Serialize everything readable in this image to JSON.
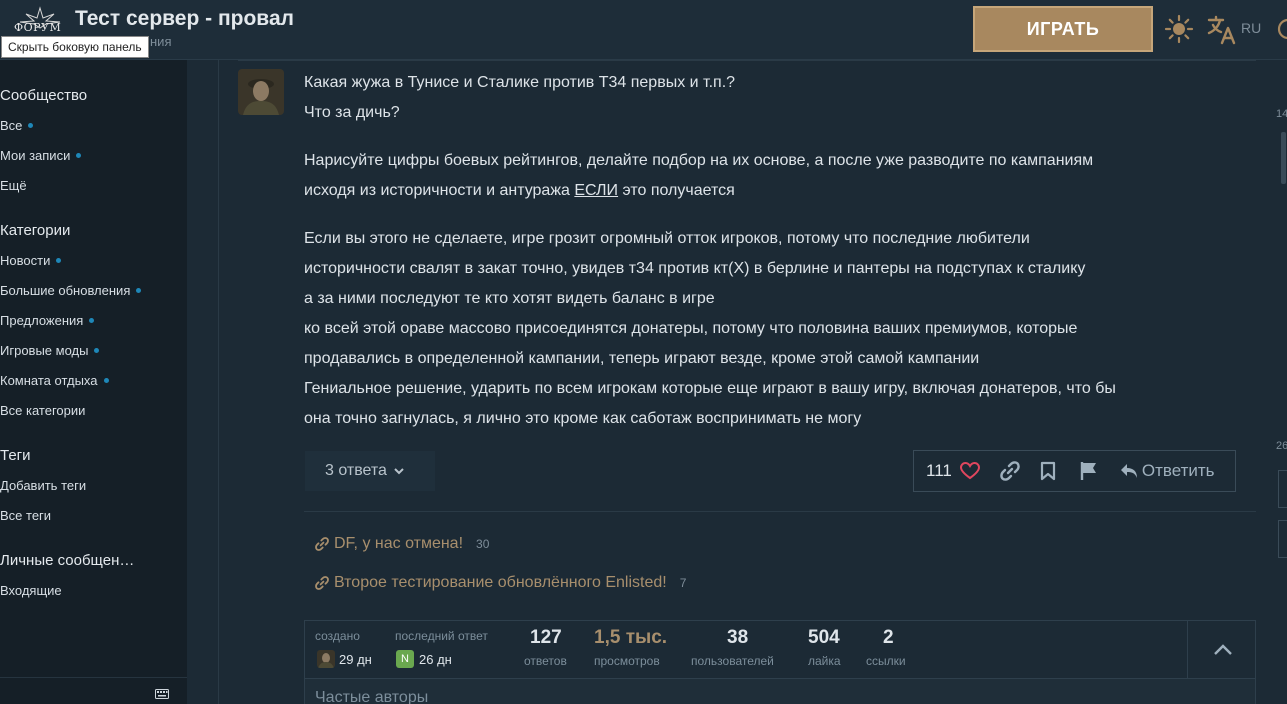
{
  "header": {
    "logo_text": "ФОРУМ",
    "title": "Тест сервер - провал",
    "subtitle": "ния",
    "tooltip": "Скрыть боковую панель",
    "play_label": "ИГРАТЬ",
    "lang": "RU",
    "icons": [
      "sun-icon",
      "translate-icon"
    ]
  },
  "sidebar": {
    "community": {
      "heading": "Сообщество",
      "items": [
        "Все",
        "Мои записи",
        "Ещё"
      ]
    },
    "categories": {
      "heading": "Категории",
      "items": [
        "Новости",
        "Большие обновления",
        "Предложения",
        "Игровые моды",
        "Комната отдыха",
        "Все категории"
      ]
    },
    "tags": {
      "heading": "Теги",
      "items": [
        "Добавить теги",
        "Все теги"
      ]
    },
    "messages": {
      "heading": "Личные сообщен…",
      "items": [
        "Входящие"
      ]
    }
  },
  "post": {
    "p1": [
      "Какая жужа в Тунисе и Сталике против Т34 первых и т.п.?",
      "Что за дичь?"
    ],
    "p2_l1": "Нарисуйте цифры боевых рейтингов, делайте подбор на их основе, а после уже разводите по кампаниям",
    "p2_l2_a": "исходя из историчности и антуража ",
    "p2_l2_u": "ЕСЛИ",
    "p2_l2_b": " это получается",
    "p3": [
      "Если вы этого не сделаете, игре грозит огромный отток игроков, потому что последние любители",
      "историчности свалят в закат точно, увидев т34 против кт(X) в берлине и пантеры на подступах к сталику",
      "а за ними последуют те кто хотят видеть баланс в игре",
      "ко всей этой ораве массово присоединятся донатеры, потому что половина ваших премиумов, которые",
      "продавались в определенной кампании, теперь играют везде, кроме этой самой кампании",
      "Гениальное решение, ударить по всем игрокам которые еще играют в вашу игру, включая донатеров, что бы",
      "она точно загнулась, я лично это кроме как саботаж воспринимать не могу"
    ],
    "replies_label": "3 ответа",
    "likes": "111",
    "reply_label": "Ответить"
  },
  "links": [
    {
      "title": "DF, у нас отмена!",
      "count": "30"
    },
    {
      "title": "Второе тестирование обновлённого Enlisted!",
      "count": "7"
    }
  ],
  "stats": {
    "created_label": "создано",
    "created_time": "29 дн",
    "last_reply_label": "последний ответ",
    "last_reply_time": "26 дн",
    "last_reply_avatar_letter": "N",
    "replies_num": "127",
    "replies_label": "ответов",
    "views_num": "1,5 тыс.",
    "views_label": "просмотров",
    "users_num": "38",
    "users_label": "пользователей",
    "likes_num": "504",
    "likes_label": "лайка",
    "links_num": "2",
    "links_label": "ссылки"
  },
  "frequent_posters": "Частые авторы",
  "timeline": {
    "top": "14",
    "bottom": "26"
  },
  "colors": {
    "accent_gold": "#a88f6d",
    "play_button": "#a8885f",
    "dot_blue": "#1e87b8",
    "background": "#1c2a35",
    "sidebar": "#151f27"
  }
}
